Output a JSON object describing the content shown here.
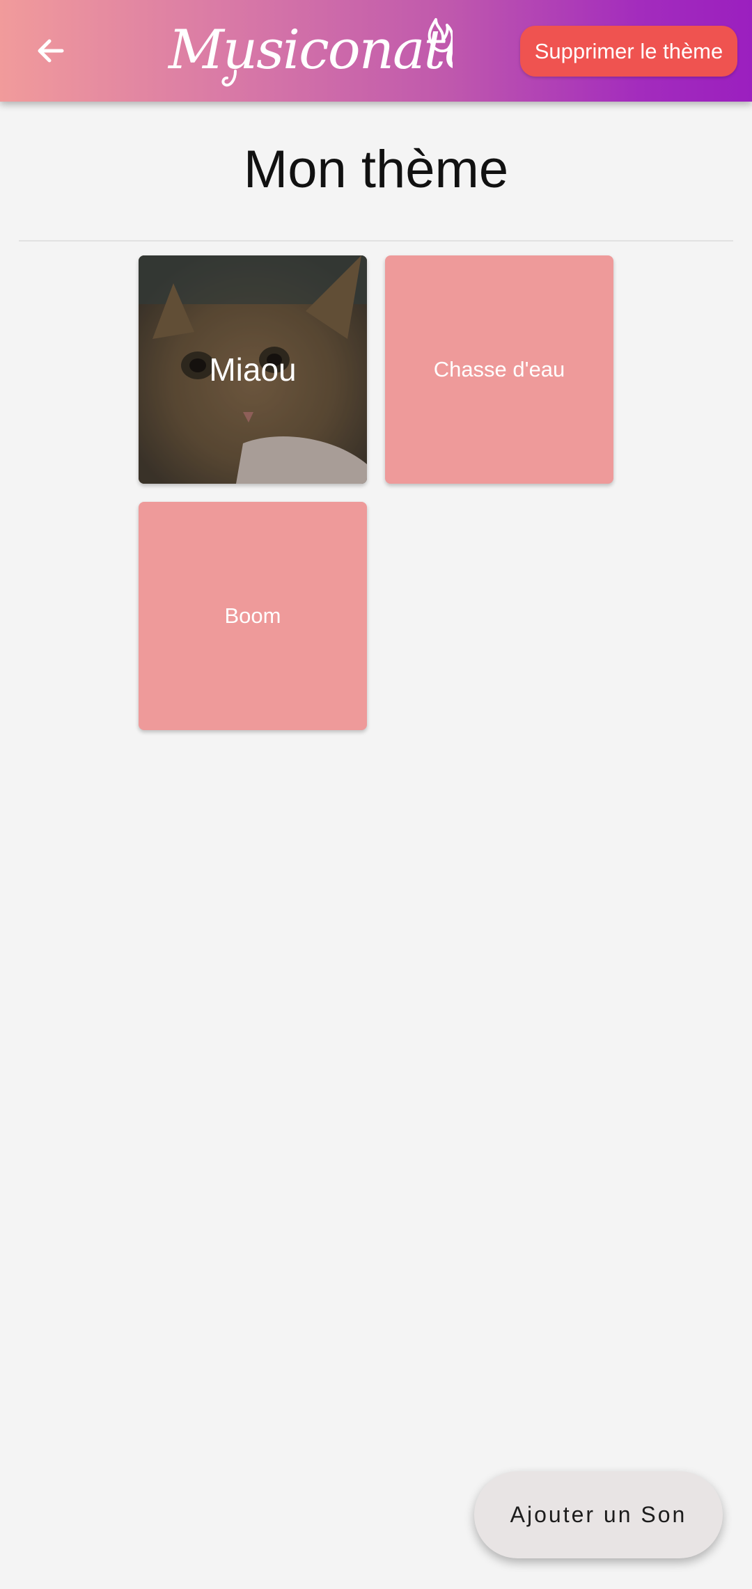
{
  "appbar": {
    "back_icon": "arrow-back-icon",
    "logo_text": "Musiconator",
    "delete_label": "Supprimer le thème",
    "gradient_start": "#f19b9b",
    "gradient_end": "#9b1fbf",
    "delete_color": "#ef5350"
  },
  "page": {
    "title": "Mon thème"
  },
  "sounds": [
    {
      "label": "Miaou",
      "has_image": true
    },
    {
      "label": "Chasse d'eau",
      "has_image": false
    },
    {
      "label": "Boom",
      "has_image": false
    }
  ],
  "tile_color": "#ee9a9a",
  "fab": {
    "label": "Ajouter un Son"
  }
}
